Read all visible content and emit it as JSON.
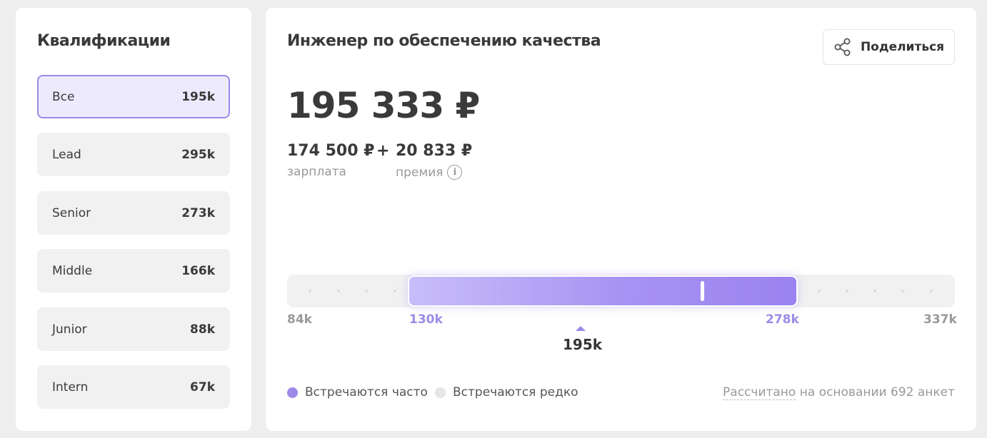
{
  "qualifications": {
    "title": "Квалификации",
    "items": [
      {
        "label": "Все",
        "value": "195k",
        "active": true
      },
      {
        "label": "Lead",
        "value": "295k"
      },
      {
        "label": "Senior",
        "value": "273k"
      },
      {
        "label": "Middle",
        "value": "166k"
      },
      {
        "label": "Junior",
        "value": "88k"
      },
      {
        "label": "Intern",
        "value": "67k"
      }
    ]
  },
  "salary": {
    "title": "Инженер по обеспечению качества",
    "share_label": "Поделиться",
    "share_icon": "share-icon",
    "total": "195 333 ₽",
    "base_value": "174 500 ₽",
    "base_label": "зарплата",
    "plus": "+",
    "bonus_value": "20 833 ₽",
    "bonus_label": "премия",
    "info_icon": "info-icon",
    "info_glyph": "i"
  },
  "range": {
    "min": "84k",
    "low": "130k",
    "high": "278k",
    "max": "337k",
    "median": "195k",
    "accent_color": "#9d8ae8"
  },
  "legend": {
    "frequent": "Встречаются часто",
    "rare": "Встречаются редко",
    "frequent_color": "#9d8ae8",
    "rare_color": "#e6e6e6"
  },
  "footnote": {
    "link": "Рассчитано",
    "rest": " на основании 692 анкет"
  }
}
